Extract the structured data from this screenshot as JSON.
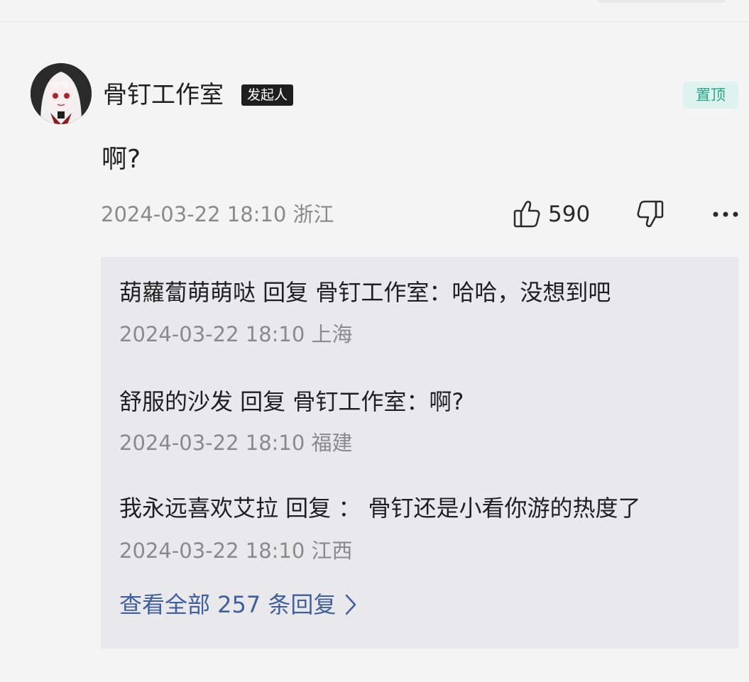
{
  "comment": {
    "author": "骨钉工作室",
    "author_badge": "发起人",
    "pin_label": "置顶",
    "text": "啊?",
    "meta": "2024-03-22 18:10 浙江",
    "likes": "590"
  },
  "replies": [
    {
      "text": "葫蘿蔔萌萌哒 回复 骨钉工作室：哈哈，没想到吧",
      "meta": "2024-03-22 18:10 上海"
    },
    {
      "text": "舒服的沙发 回复 骨钉工作室：啊?",
      "meta": "2024-03-22 18:10 福建"
    },
    {
      "text": "我永远喜欢艾拉 回复 ：  骨钉还是小看你游的热度了",
      "meta": "2024-03-22 18:10 江西"
    }
  ],
  "view_all_label": "查看全部 257 条回复",
  "icons": {
    "like": "thumbs-up-icon",
    "dislike": "thumbs-down-icon",
    "more": "more-dots-icon",
    "view_all": "chevron-right-icon"
  },
  "colors": {
    "pin_bg": "#dff3ee",
    "pin_text": "#26a68d",
    "link": "#3f5f9e",
    "badge_bg": "#1e1e1e"
  }
}
